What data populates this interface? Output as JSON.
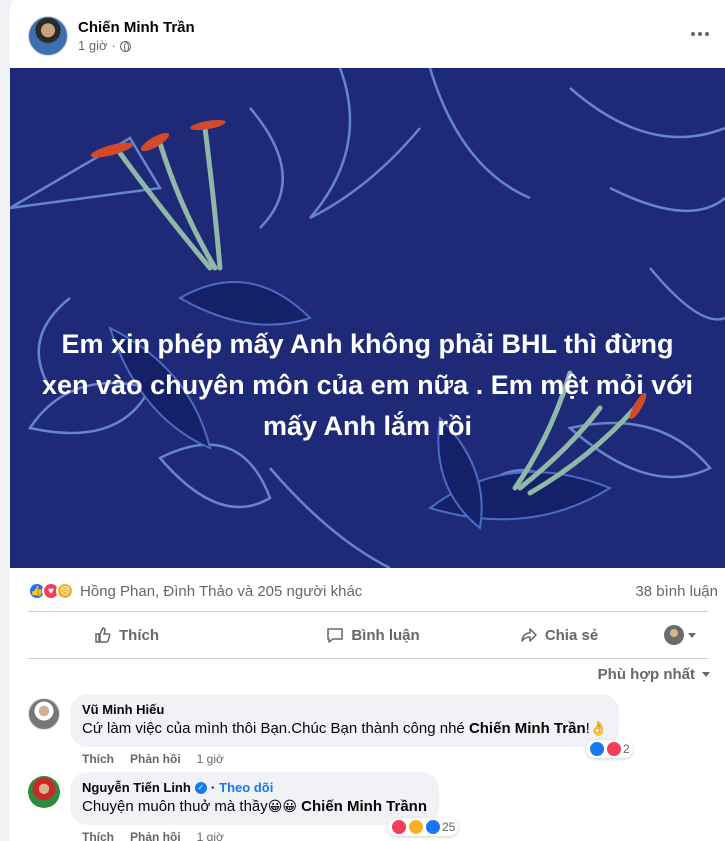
{
  "post": {
    "author": "Chiến Minh Trần",
    "time": "1 giờ",
    "privacy_icon": "globe-icon",
    "text": "Em xin phép mấy Anh không phải BHL thì đừng xen vào chuyên môn của em nữa . Em mệt mỏi với mấy Anh lắm rồi",
    "background_color": "#1e2a78"
  },
  "reactions": {
    "names": "Hồng Phan, Đình Thảo và 205 người khác",
    "comments": "38 bình luận",
    "icons": [
      "like-icon",
      "love-icon",
      "sad-icon"
    ]
  },
  "actions": {
    "like": "Thích",
    "comment": "Bình luận",
    "share": "Chia sẻ"
  },
  "sort_label": "Phù hợp nhất",
  "comments": [
    {
      "name": "Vũ Minh Hiếu",
      "text": "Cứ làm việc của mình thôi Bạn.Chúc Bạn thành công nhé ",
      "tag": "Chiến Minh Trần",
      "suffix": "!",
      "emoji": "👌",
      "like": "Thích",
      "reply": "Phản hồi",
      "time": "1 giờ",
      "reaction_count": "2"
    },
    {
      "name": "Nguyễn Tiến Linh",
      "follow": "Theo dõi",
      "text": "Chuyện muôn thuở mà thầy",
      "emoji": "😀😀",
      "tag": "Chiến Minh Trầnn",
      "like": "Thích",
      "reply": "Phản hồi",
      "time": "1 giờ",
      "reaction_count": "25"
    }
  ]
}
